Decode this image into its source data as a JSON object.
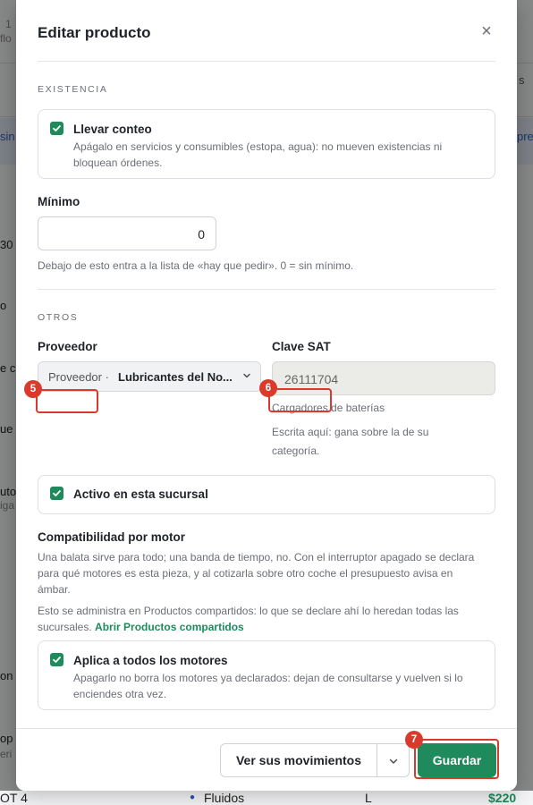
{
  "background": {
    "fragments": [
      "1",
      "flo",
      "sin",
      "30",
      "o",
      "e c",
      "ue",
      "uto",
      "iga",
      "on",
      "op",
      "eri",
      "pre",
      "s"
    ],
    "bottom_row": {
      "left": "OT 4",
      "category": "Fluidos",
      "col": "L",
      "price": "$220"
    }
  },
  "modal": {
    "title": "Editar producto",
    "close_label": "×"
  },
  "existencia": {
    "section_label": "EXISTENCIA",
    "llevar_conteo": {
      "title": "Llevar conteo",
      "checked": true,
      "description": "Apágalo en servicios y consumibles (estopa, agua): no mueven existencias ni bloquean órdenes."
    },
    "minimo": {
      "label": "Mínimo",
      "value": "0",
      "help": "Debajo de esto entra a la lista de «hay que pedir». 0 = sin mínimo."
    }
  },
  "otros": {
    "section_label": "OTROS",
    "proveedor": {
      "label": "Proveedor",
      "prefix": "Proveedor ·",
      "value": "Lubricantes del No..."
    },
    "clave_sat": {
      "label": "Clave SAT",
      "value": "26111704",
      "description": "Cargadores de baterías",
      "help": "Escrita aquí: gana sobre la de su categoría."
    },
    "activo": {
      "title": "Activo en esta sucursal",
      "checked": true
    },
    "compatibilidad": {
      "title": "Compatibilidad por motor",
      "description": "Una balata sirve para todo; una banda de tiempo, no. Con el interruptor apagado se declara para qué motores es esta pieza, y al cotizarla sobre otro coche el presupuesto avisa en ámbar.",
      "note": "Esto se administra en Productos compartidos: lo que se declare ahí lo heredan todas las sucursales.",
      "link": "Abrir Productos compartidos",
      "aplica": {
        "title": "Aplica a todos los motores",
        "checked": true,
        "description": "Apagarlo no borra los motores ya declarados: dejan de consultarse y vuelven si lo enciendes otra vez."
      }
    }
  },
  "footer": {
    "movimientos_label": "Ver sus movimientos",
    "guardar_label": "Guardar"
  },
  "annotations": [
    "5",
    "6",
    "7"
  ],
  "colors": {
    "accent": "#1f8a5b",
    "annotation": "#d93a2b"
  }
}
